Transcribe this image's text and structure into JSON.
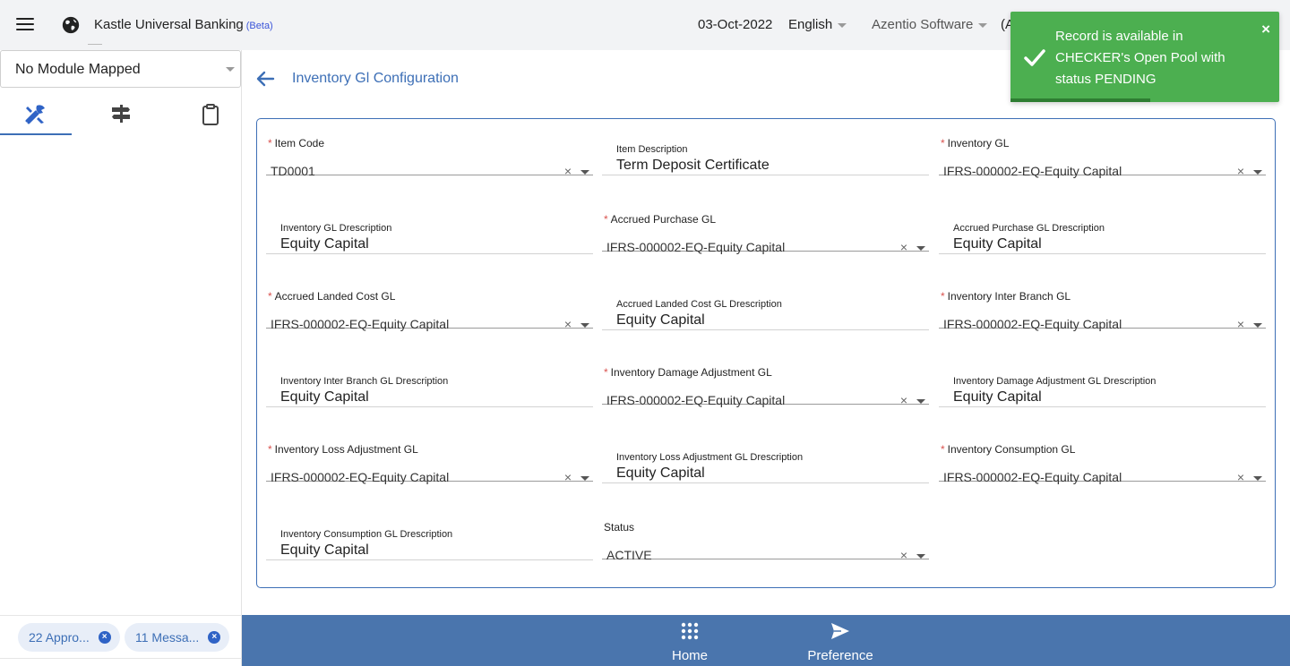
{
  "header": {
    "app_title": "Kastle Universal Banking",
    "beta": "(Beta)",
    "date": "03-Oct-2022",
    "language": "English",
    "organization": "Azentio Software",
    "extra": "(A"
  },
  "toast": {
    "message": "Record is available in CHECKER's Open Pool with status PENDING",
    "close": "×",
    "color": "#4caf50"
  },
  "sidebar": {
    "module": "No Module Mapped",
    "tabs": [
      {
        "icon": "tools-icon",
        "active": true
      },
      {
        "icon": "signpost-icon",
        "active": false
      },
      {
        "icon": "clipboard-icon",
        "active": false
      }
    ],
    "chips": [
      {
        "label": "22 Appro..."
      },
      {
        "label": "11 Messa..."
      }
    ]
  },
  "page": {
    "title": "Inventory Gl Configuration"
  },
  "form": {
    "item_code": {
      "label": "Item Code",
      "value": "TD0001",
      "required": true
    },
    "item_description": {
      "label": "Item Description",
      "value": "Term Deposit Certificate"
    },
    "inventory_gl": {
      "label": "Inventory GL",
      "value": "IFRS-000002-EQ-Equity Capital",
      "required": true
    },
    "inventory_gl_desc": {
      "label": "Inventory GL Drescription",
      "value": "Equity Capital"
    },
    "accrued_purchase_gl": {
      "label": "Accrued Purchase GL",
      "value": "IFRS-000002-EQ-Equity Capital",
      "required": true
    },
    "accrued_purchase_gl_desc": {
      "label": "Accrued Purchase GL Drescription",
      "value": "Equity Capital"
    },
    "accrued_landed_cost_gl": {
      "label": "Accrued Landed Cost GL",
      "value": "IFRS-000002-EQ-Equity Capital",
      "required": true
    },
    "accrued_landed_cost_gl_desc": {
      "label": "Accrued Landed Cost GL Drescription",
      "value": "Equity Capital"
    },
    "inventory_inter_branch_gl": {
      "label": "Inventory Inter Branch GL",
      "value": "IFRS-000002-EQ-Equity Capital",
      "required": true
    },
    "inventory_inter_branch_gl_desc": {
      "label": "Inventory Inter Branch GL Drescription",
      "value": "Equity Capital"
    },
    "inventory_damage_adj_gl": {
      "label": "Inventory Damage Adjustment GL",
      "value": "IFRS-000002-EQ-Equity Capital",
      "required": true
    },
    "inventory_damage_adj_gl_desc": {
      "label": "Inventory Damage Adjustment GL Drescription",
      "value": "Equity Capital"
    },
    "inventory_loss_adj_gl": {
      "label": "Inventory Loss Adjustment GL",
      "value": "IFRS-000002-EQ-Equity Capital",
      "required": true
    },
    "inventory_loss_adj_gl_desc": {
      "label": "Inventory Loss Adjustment GL Drescription",
      "value": "Equity Capital"
    },
    "inventory_consumption_gl": {
      "label": "Inventory Consumption GL",
      "value": "IFRS-000002-EQ-Equity Capital",
      "required": true
    },
    "inventory_consumption_gl_desc": {
      "label": "Inventory Consumption GL Drescription",
      "value": "Equity Capital"
    },
    "status": {
      "label": "Status",
      "value": "ACTIVE"
    },
    "clear_glyph": "×"
  },
  "bottom_nav": {
    "home": "Home",
    "preference": "Preference"
  },
  "colors": {
    "accent": "#3d6fb6",
    "bottom_bar": "#4a75ad",
    "required_star": "#d9534f"
  }
}
